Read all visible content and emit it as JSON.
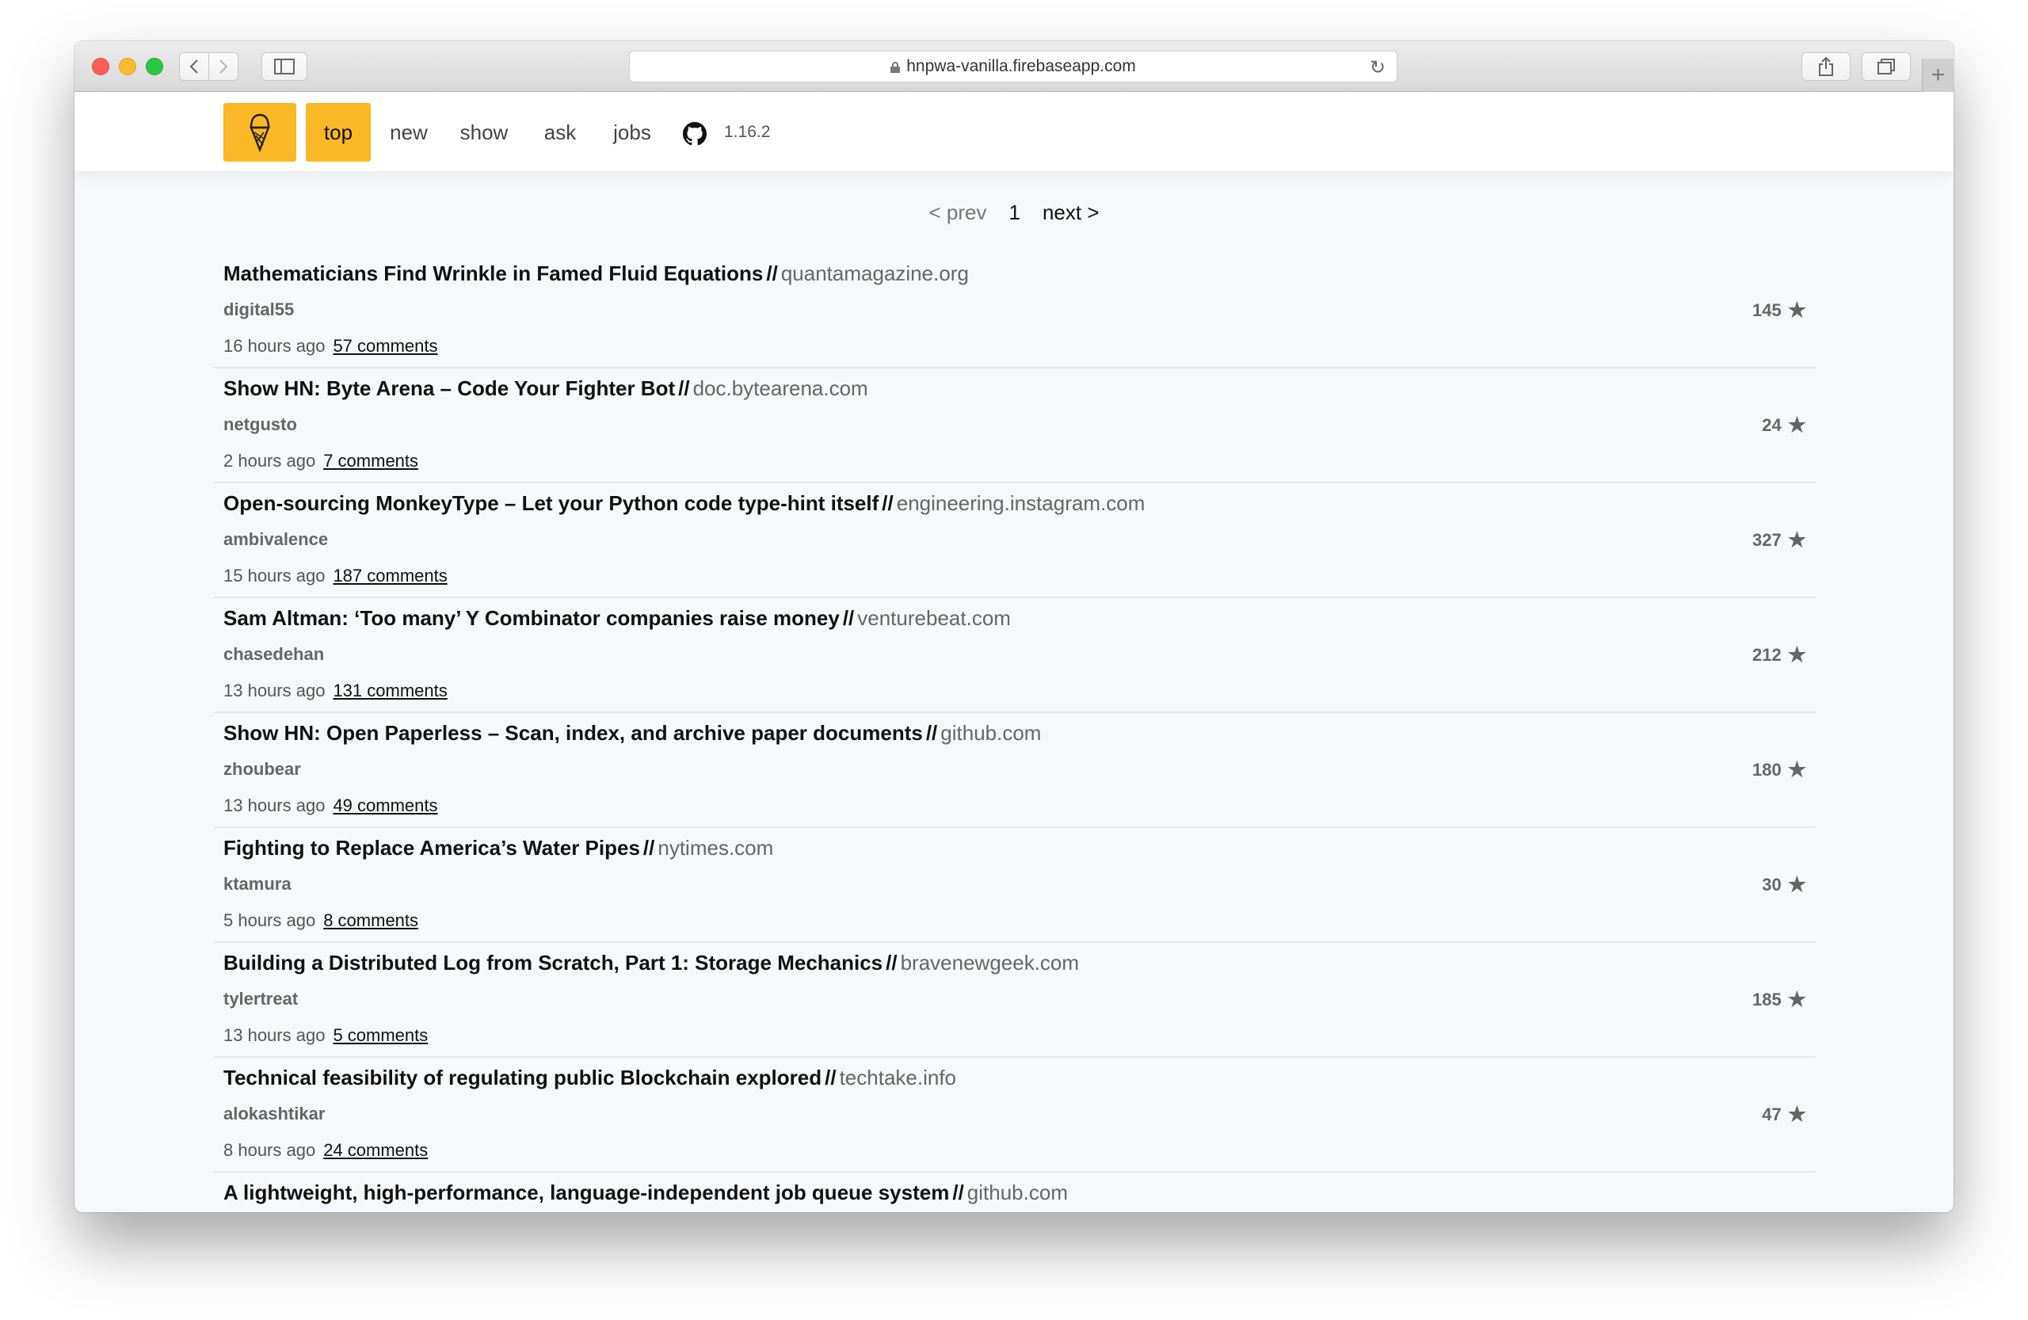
{
  "browser": {
    "url": "hnpwa-vanilla.firebaseapp.com"
  },
  "nav": {
    "items": [
      "top",
      "new",
      "show",
      "ask",
      "jobs"
    ],
    "active": "top",
    "version": "1.16.2"
  },
  "pager": {
    "prev": "< prev",
    "page": "1",
    "next": "next >"
  },
  "stories": [
    {
      "title": "Mathematicians Find Wrinkle in Famed Fluid Equations",
      "domain": "quantamagazine.org",
      "user": "digital55",
      "time": "16 hours ago",
      "comments": "57 comments",
      "score": "145"
    },
    {
      "title": "Show HN: Byte Arena – Code Your Fighter Bot",
      "domain": "doc.bytearena.com",
      "user": "netgusto",
      "time": "2 hours ago",
      "comments": "7 comments",
      "score": "24"
    },
    {
      "title": "Open-sourcing MonkeyType – Let your Python code type-hint itself",
      "domain": "engineering.instagram.com",
      "user": "ambivalence",
      "time": "15 hours ago",
      "comments": "187 comments",
      "score": "327"
    },
    {
      "title": "Sam Altman: ‘Too many’ Y Combinator companies raise money",
      "domain": "venturebeat.com",
      "user": "chasedehan",
      "time": "13 hours ago",
      "comments": "131 comments",
      "score": "212"
    },
    {
      "title": "Show HN: Open Paperless – Scan, index, and archive paper documents",
      "domain": "github.com",
      "user": "zhoubear",
      "time": "13 hours ago",
      "comments": "49 comments",
      "score": "180"
    },
    {
      "title": "Fighting to Replace America’s Water Pipes",
      "domain": "nytimes.com",
      "user": "ktamura",
      "time": "5 hours ago",
      "comments": "8 comments",
      "score": "30"
    },
    {
      "title": "Building a Distributed Log from Scratch, Part 1: Storage Mechanics",
      "domain": "bravenewgeek.com",
      "user": "tylertreat",
      "time": "13 hours ago",
      "comments": "5 comments",
      "score": "185"
    },
    {
      "title": "Technical feasibility of regulating public Blockchain explored",
      "domain": "techtake.info",
      "user": "alokashtikar",
      "time": "8 hours ago",
      "comments": "24 comments",
      "score": "47"
    },
    {
      "title": "A lightweight, high-performance, language-independent job queue system",
      "domain": "github.com",
      "user": "",
      "time": "",
      "comments": "",
      "score": ""
    }
  ],
  "colors": {
    "accent": "#fbb826",
    "background": "#f7f8fb"
  }
}
